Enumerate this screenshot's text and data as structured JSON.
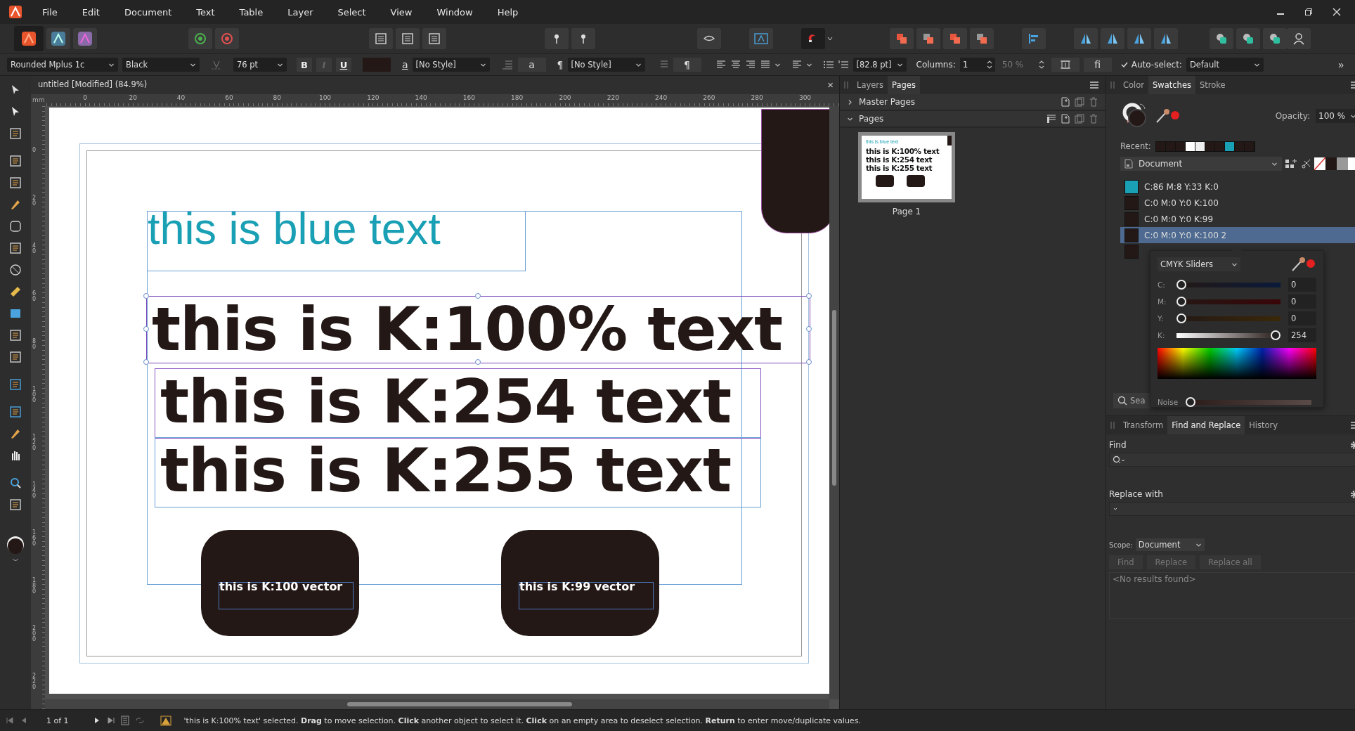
{
  "menu": [
    "File",
    "Edit",
    "Document",
    "Text",
    "Table",
    "Layer",
    "Select",
    "View",
    "Window",
    "Help"
  ],
  "context_bar": {
    "font": "Rounded Mplus 1c",
    "font_style": "Black",
    "font_size": "76 pt",
    "format_buttons": [
      "B",
      "I",
      "U"
    ],
    "char_glyph": "a",
    "char_style": "[No Style]",
    "case_glyph": "a",
    "para_glyph": "¶",
    "para_style": "[No Style]",
    "para_glyph_2": "¶",
    "leading": "[82.8 pt]",
    "columns_label": "Columns:",
    "columns": "1",
    "gutter": "50 %",
    "ligature_glyph": "fi",
    "auto_select": {
      "label": "Auto-select:",
      "checked": true
    },
    "auto_select_value": "Default",
    "more_glyph": "»"
  },
  "document_tab": {
    "title": "untitled [Modified] (84.9%)",
    "close": "×"
  },
  "ruler": {
    "unit": "mm",
    "x_labels": [
      "0",
      "20",
      "40",
      "60",
      "80",
      "100",
      "120",
      "140",
      "160",
      "180",
      "200",
      "220",
      "240",
      "260",
      "280",
      "300"
    ],
    "y_labels": [
      "0",
      "20",
      "40",
      "60",
      "80",
      "100",
      "120",
      "140",
      "160",
      "180",
      "200",
      "220"
    ]
  },
  "canvas": {
    "blue_text": "this is blue text",
    "texts": [
      {
        "text": "this is K:100% text",
        "selected": true
      },
      {
        "text": "this is K:254 text",
        "selected": false
      },
      {
        "text": "this is K:255 text",
        "selected": false
      }
    ],
    "vectors": [
      "this is K:100 vector",
      "this is K:99 vector"
    ]
  },
  "pages_panel": {
    "tabs": [
      {
        "label": "Layers",
        "selected": false
      },
      {
        "label": "Pages",
        "selected": true
      }
    ],
    "sections": [
      {
        "label": "Master Pages",
        "expanded": false
      },
      {
        "label": "Pages",
        "expanded": true
      }
    ],
    "thumbnail": {
      "blue_text": "this is blue text",
      "texts": [
        "this is K:100% text",
        "this is K:254 text",
        "this is K:255 text"
      ]
    },
    "page_label": "Page 1"
  },
  "swatches_panel": {
    "tabs": [
      {
        "label": "Color",
        "selected": false
      },
      {
        "label": "Swatches",
        "selected": true
      },
      {
        "label": "Stroke",
        "selected": false
      }
    ],
    "opacity_label": "Opacity:",
    "opacity": "100 %",
    "recent_label": "Recent:",
    "recent": [
      {
        "color": "#231815"
      },
      {
        "color": "#231815"
      },
      {
        "color": "#231815"
      },
      {
        "color": "#ffffff"
      },
      {
        "color": "#eeeeee"
      },
      {
        "color": "#231815"
      },
      {
        "color": "#231815"
      },
      {
        "color": "#1aa0b4"
      },
      {
        "color": "#231815"
      },
      {
        "color": "#231815"
      }
    ],
    "palette": "Document",
    "swatches": [
      {
        "name": "C:86 M:8 Y:33 K:0",
        "color": "#1aa0b4",
        "selected": false
      },
      {
        "name": "C:0 M:0 Y:0 K:100",
        "color": "#231815",
        "selected": false
      },
      {
        "name": "C:0 M:0 Y:0 K:99",
        "color": "#231815",
        "selected": false
      },
      {
        "name": "C:0 M:0 Y:0 K:100 2",
        "color": "#231815",
        "selected": true
      },
      {
        "color": "#231815",
        "selected": false
      }
    ],
    "search_placeholder": "Sea"
  },
  "color_popup": {
    "mode": "CMYK Sliders",
    "sliders": [
      {
        "label": "C:",
        "level": 0,
        "value": "0"
      },
      {
        "label": "M:",
        "level": 0,
        "value": "0"
      },
      {
        "label": "Y:",
        "level": 0,
        "value": "0"
      },
      {
        "label": "K:",
        "level": 1,
        "value": "254"
      }
    ],
    "noise": {
      "label": "Noise",
      "level": 0
    }
  },
  "find_panel": {
    "tabs": [
      {
        "label": "Transform",
        "selected": false
      },
      {
        "label": "Find and Replace",
        "selected": true
      },
      {
        "label": "History",
        "selected": false
      }
    ],
    "find_label": "Find",
    "replace_label": "Replace with",
    "scope_label": "Scope:",
    "scope": "Document",
    "buttons": [
      {
        "label": "Find",
        "disabled": true
      },
      {
        "label": "Replace",
        "disabled": true
      },
      {
        "label": "Replace all",
        "disabled": true
      }
    ],
    "results": "<No results found>"
  },
  "status_bar": {
    "page": "1 of 1",
    "message": "'this is K:100% text' selected. **Drag** to move selection. **Click** another object to select it. **Click** on an empty area to deselect selection. **Return** to enter move/duplicate values."
  }
}
